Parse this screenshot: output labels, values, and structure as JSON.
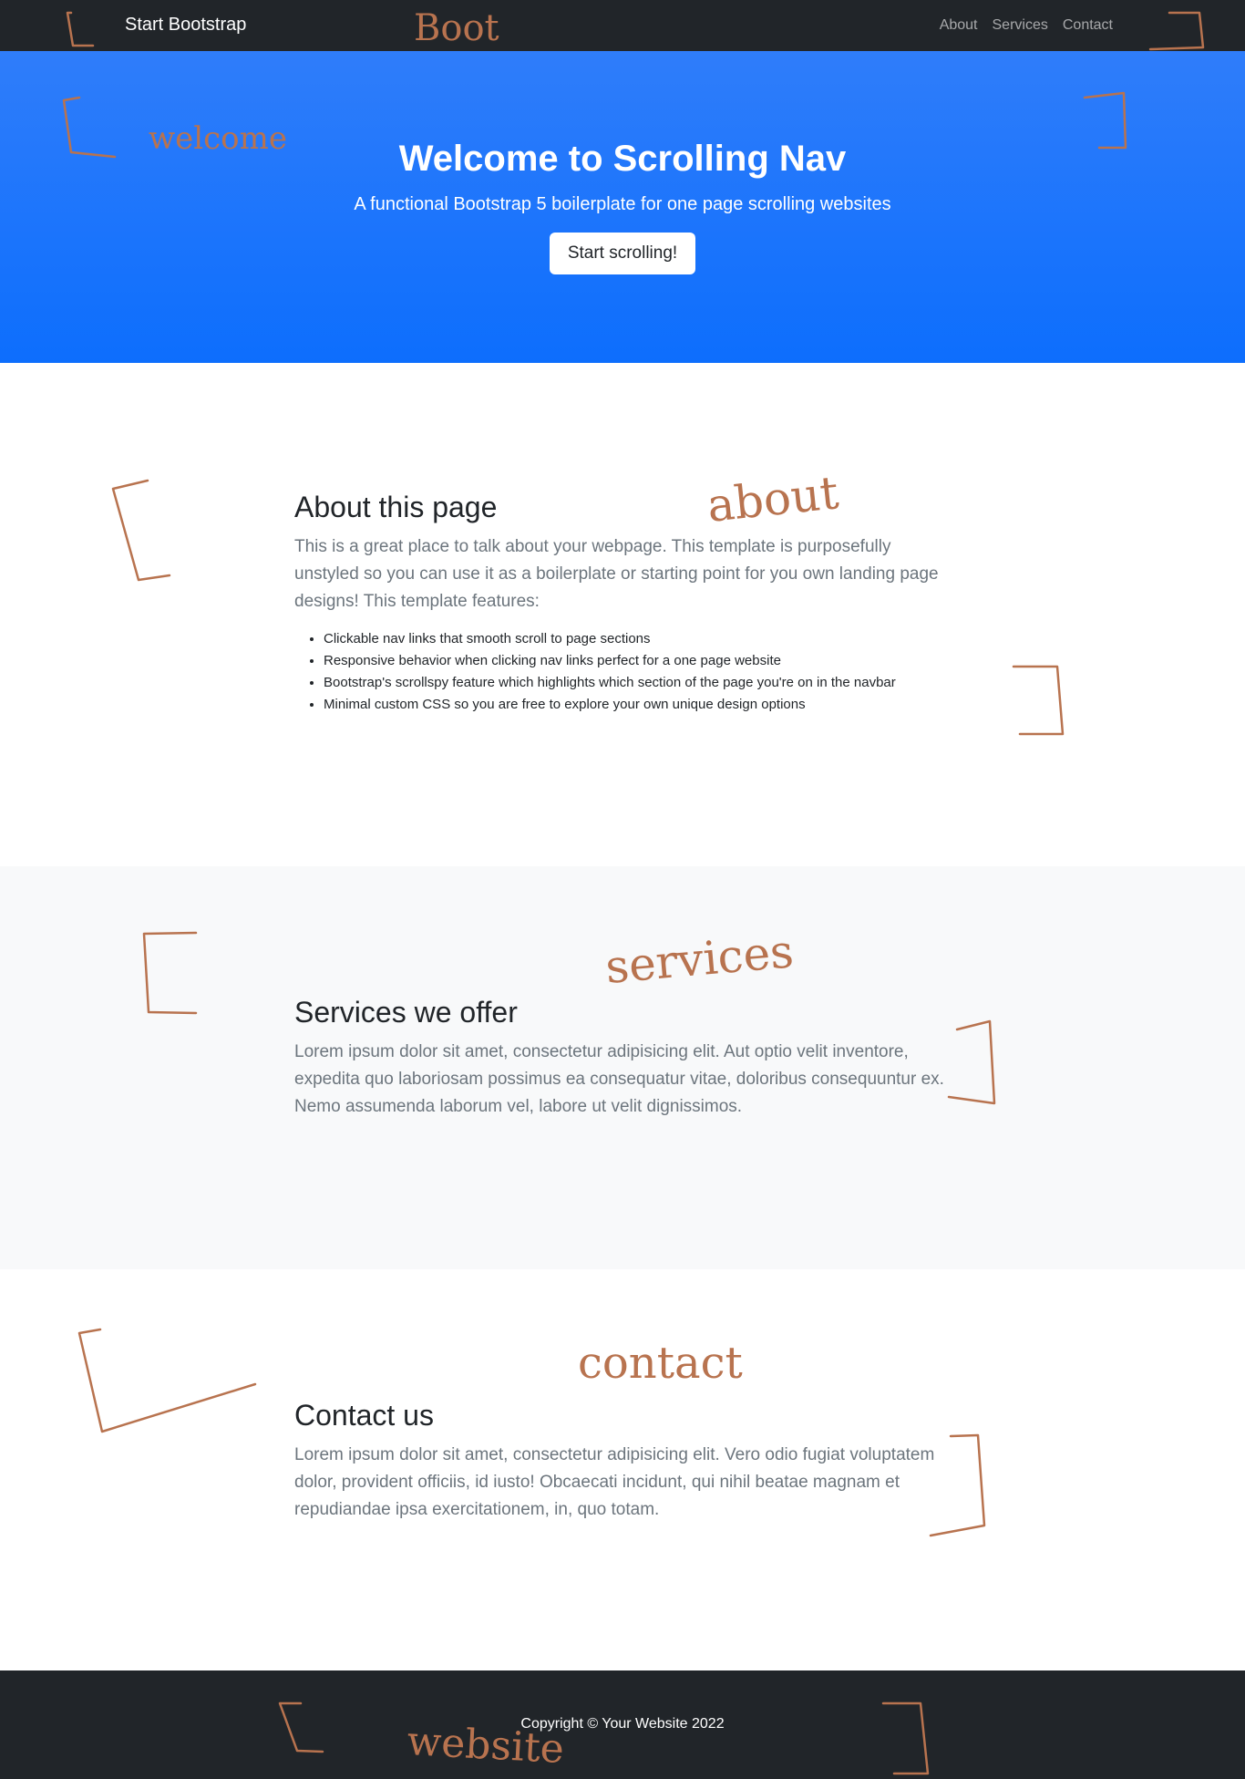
{
  "navbar": {
    "brand": "Start Bootstrap",
    "links": [
      {
        "label": "About"
      },
      {
        "label": "Services"
      },
      {
        "label": "Contact"
      }
    ]
  },
  "hero": {
    "title": "Welcome to Scrolling Nav",
    "subtitle": "A functional Bootstrap 5 boilerplate for one page scrolling websites",
    "button": "Start scrolling!"
  },
  "about": {
    "heading": "About this page",
    "lead": "This is a great place to talk about your webpage. This template is purposefully unstyled so you can use it as a boilerplate or starting point for you own landing page designs! This template features:",
    "features": [
      "Clickable nav links that smooth scroll to page sections",
      "Responsive behavior when clicking nav links perfect for a one page website",
      "Bootstrap's scrollspy feature which highlights which section of the page you're on in the navbar",
      "Minimal custom CSS so you are free to explore your own unique design options"
    ]
  },
  "services": {
    "heading": "Services we offer",
    "lead": "Lorem ipsum dolor sit amet, consectetur adipisicing elit. Aut optio velit inventore, expedita quo laboriosam possimus ea consequatur vitae, doloribus consequuntur ex. Nemo assumenda laborum vel, labore ut velit dignissimos."
  },
  "contact": {
    "heading": "Contact us",
    "lead": "Lorem ipsum dolor sit amet, consectetur adipisicing elit. Vero odio fugiat voluptatem dolor, provident officiis, id iusto! Obcaecati incidunt, qui nihil beatae magnam et repudiandae ipsa exercitationem, in, quo totam."
  },
  "footer": {
    "copyright": "Copyright © Your Website 2022"
  },
  "annotations": {
    "labels": [
      "Boot",
      "welcome",
      "about",
      "services",
      "contact",
      "website"
    ]
  },
  "colors": {
    "navbar_bg": "#212529",
    "hero_primary": "#0d6efd",
    "services_bg": "#f8f9fa",
    "annotation": "#b8734f"
  }
}
